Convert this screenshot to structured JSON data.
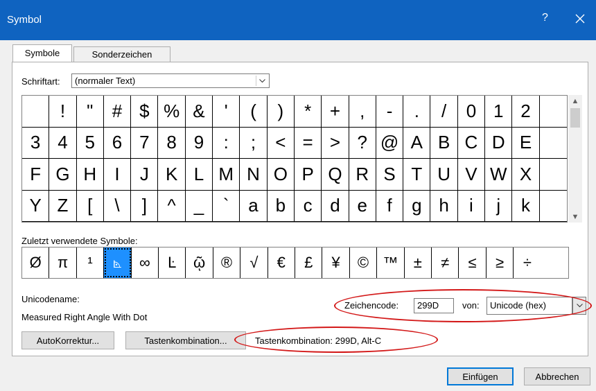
{
  "window": {
    "title": "Symbol",
    "help": "?"
  },
  "tabs": [
    {
      "label": "Symbole",
      "active": true
    },
    {
      "label": "Sonderzeichen",
      "active": false
    }
  ],
  "font": {
    "label": "Schriftart:",
    "value": "(normaler Text)"
  },
  "symbols": [
    " ",
    "!",
    "\"",
    "#",
    "$",
    "%",
    "&",
    "'",
    "(",
    ")",
    "*",
    "+",
    ",",
    "-",
    ".",
    "/",
    "0",
    "1",
    "2",
    "",
    "3",
    "4",
    "5",
    "6",
    "7",
    "8",
    "9",
    ":",
    ";",
    "<",
    "=",
    ">",
    "?",
    "@",
    "A",
    "B",
    "C",
    "D",
    "E",
    "",
    "F",
    "G",
    "H",
    "I",
    "J",
    "K",
    "L",
    "M",
    "N",
    "O",
    "P",
    "Q",
    "R",
    "S",
    "T",
    "U",
    "V",
    "W",
    "X",
    "",
    "Y",
    "Z",
    "[",
    "\\",
    "]",
    "^",
    "_",
    "`",
    "a",
    "b",
    "c",
    "d",
    "e",
    "f",
    "g",
    "h",
    "i",
    "j",
    "k",
    ""
  ],
  "recent": {
    "label": "Zuletzt verwendete Symbole:",
    "symbols": [
      "Ø",
      "π",
      "¹",
      "⦝",
      "∞",
      "Ŀ",
      "ῷ",
      "®",
      "√",
      "€",
      "£",
      "¥",
      "©",
      "™",
      "±",
      "≠",
      "≤",
      "≥",
      "÷"
    ],
    "selected_index": 3
  },
  "unicode": {
    "label": "Unicodename:",
    "value": "Measured Right Angle With Dot"
  },
  "charcode": {
    "label": "Zeichencode:",
    "value": "299D"
  },
  "from": {
    "label": "von:",
    "value": "Unicode (hex)"
  },
  "buttons": {
    "autokorrektur": "AutoKorrektur...",
    "tastenkombination": "Tastenkombination...",
    "einfuegen": "Einfügen",
    "abbrechen": "Abbrechen"
  },
  "shortcut_text": "Tastenkombination: 299D, Alt-C",
  "colors": {
    "titlebar": "#0f63c0",
    "selection": "#1e90ff",
    "highlight": "#d31818"
  }
}
